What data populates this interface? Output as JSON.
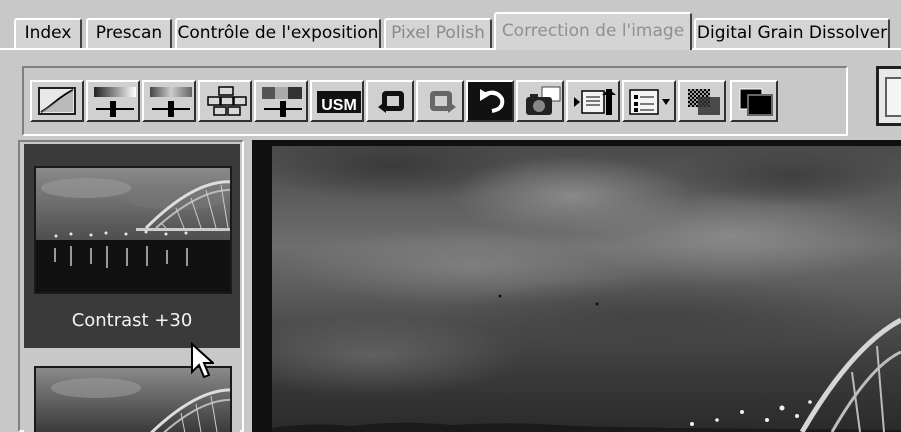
{
  "tabs": [
    {
      "label": "Index",
      "state": "normal"
    },
    {
      "label": "Prescan",
      "state": "normal"
    },
    {
      "label": "Contrôle de l'exposition",
      "state": "normal"
    },
    {
      "label": "Pixel Polish",
      "state": "disabled"
    },
    {
      "label": "Correction de l'image",
      "state": "active"
    },
    {
      "label": "Digital Grain Dissolver",
      "state": "normal"
    }
  ],
  "toolbar": {
    "buttons": [
      {
        "icon": "tone-curve-icon"
      },
      {
        "icon": "brightness-contrast-slider-icon"
      },
      {
        "icon": "color-balance-slider-icon"
      },
      {
        "icon": "variations-grid-icon"
      },
      {
        "icon": "hue-saturation-icon"
      },
      {
        "icon": "usm-sharpen-icon",
        "text": "USM"
      },
      {
        "icon": "undo-icon"
      },
      {
        "icon": "redo-icon"
      },
      {
        "icon": "reset-icon"
      },
      {
        "icon": "snapshot-camera-icon"
      },
      {
        "icon": "load-settings-icon"
      },
      {
        "icon": "job-list-dropdown-icon"
      },
      {
        "icon": "compare-overlay-icon"
      },
      {
        "icon": "before-after-icon"
      }
    ]
  },
  "thumbnails": [
    {
      "caption": "Contrast +30"
    },
    {
      "caption": ""
    }
  ],
  "colors": {
    "background": "#c8c8c8",
    "thumb_card_selected": "#3a3a3a",
    "preview_background": "#101010"
  }
}
